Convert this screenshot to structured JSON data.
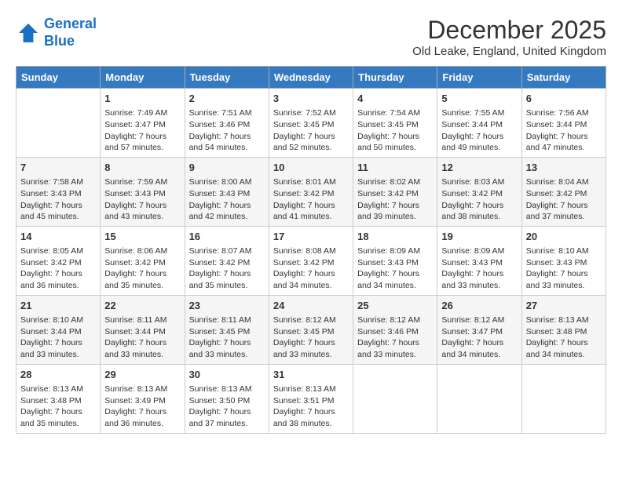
{
  "header": {
    "logo_line1": "General",
    "logo_line2": "Blue",
    "title": "December 2025",
    "subtitle": "Old Leake, England, United Kingdom"
  },
  "days_of_week": [
    "Sunday",
    "Monday",
    "Tuesday",
    "Wednesday",
    "Thursday",
    "Friday",
    "Saturday"
  ],
  "weeks": [
    [
      {
        "day": "",
        "info": ""
      },
      {
        "day": "1",
        "info": "Sunrise: 7:49 AM\nSunset: 3:47 PM\nDaylight: 7 hours\nand 57 minutes."
      },
      {
        "day": "2",
        "info": "Sunrise: 7:51 AM\nSunset: 3:46 PM\nDaylight: 7 hours\nand 54 minutes."
      },
      {
        "day": "3",
        "info": "Sunrise: 7:52 AM\nSunset: 3:45 PM\nDaylight: 7 hours\nand 52 minutes."
      },
      {
        "day": "4",
        "info": "Sunrise: 7:54 AM\nSunset: 3:45 PM\nDaylight: 7 hours\nand 50 minutes."
      },
      {
        "day": "5",
        "info": "Sunrise: 7:55 AM\nSunset: 3:44 PM\nDaylight: 7 hours\nand 49 minutes."
      },
      {
        "day": "6",
        "info": "Sunrise: 7:56 AM\nSunset: 3:44 PM\nDaylight: 7 hours\nand 47 minutes."
      }
    ],
    [
      {
        "day": "7",
        "info": "Sunrise: 7:58 AM\nSunset: 3:43 PM\nDaylight: 7 hours\nand 45 minutes."
      },
      {
        "day": "8",
        "info": "Sunrise: 7:59 AM\nSunset: 3:43 PM\nDaylight: 7 hours\nand 43 minutes."
      },
      {
        "day": "9",
        "info": "Sunrise: 8:00 AM\nSunset: 3:43 PM\nDaylight: 7 hours\nand 42 minutes."
      },
      {
        "day": "10",
        "info": "Sunrise: 8:01 AM\nSunset: 3:42 PM\nDaylight: 7 hours\nand 41 minutes."
      },
      {
        "day": "11",
        "info": "Sunrise: 8:02 AM\nSunset: 3:42 PM\nDaylight: 7 hours\nand 39 minutes."
      },
      {
        "day": "12",
        "info": "Sunrise: 8:03 AM\nSunset: 3:42 PM\nDaylight: 7 hours\nand 38 minutes."
      },
      {
        "day": "13",
        "info": "Sunrise: 8:04 AM\nSunset: 3:42 PM\nDaylight: 7 hours\nand 37 minutes."
      }
    ],
    [
      {
        "day": "14",
        "info": "Sunrise: 8:05 AM\nSunset: 3:42 PM\nDaylight: 7 hours\nand 36 minutes."
      },
      {
        "day": "15",
        "info": "Sunrise: 8:06 AM\nSunset: 3:42 PM\nDaylight: 7 hours\nand 35 minutes."
      },
      {
        "day": "16",
        "info": "Sunrise: 8:07 AM\nSunset: 3:42 PM\nDaylight: 7 hours\nand 35 minutes."
      },
      {
        "day": "17",
        "info": "Sunrise: 8:08 AM\nSunset: 3:42 PM\nDaylight: 7 hours\nand 34 minutes."
      },
      {
        "day": "18",
        "info": "Sunrise: 8:09 AM\nSunset: 3:43 PM\nDaylight: 7 hours\nand 34 minutes."
      },
      {
        "day": "19",
        "info": "Sunrise: 8:09 AM\nSunset: 3:43 PM\nDaylight: 7 hours\nand 33 minutes."
      },
      {
        "day": "20",
        "info": "Sunrise: 8:10 AM\nSunset: 3:43 PM\nDaylight: 7 hours\nand 33 minutes."
      }
    ],
    [
      {
        "day": "21",
        "info": "Sunrise: 8:10 AM\nSunset: 3:44 PM\nDaylight: 7 hours\nand 33 minutes."
      },
      {
        "day": "22",
        "info": "Sunrise: 8:11 AM\nSunset: 3:44 PM\nDaylight: 7 hours\nand 33 minutes."
      },
      {
        "day": "23",
        "info": "Sunrise: 8:11 AM\nSunset: 3:45 PM\nDaylight: 7 hours\nand 33 minutes."
      },
      {
        "day": "24",
        "info": "Sunrise: 8:12 AM\nSunset: 3:45 PM\nDaylight: 7 hours\nand 33 minutes."
      },
      {
        "day": "25",
        "info": "Sunrise: 8:12 AM\nSunset: 3:46 PM\nDaylight: 7 hours\nand 33 minutes."
      },
      {
        "day": "26",
        "info": "Sunrise: 8:12 AM\nSunset: 3:47 PM\nDaylight: 7 hours\nand 34 minutes."
      },
      {
        "day": "27",
        "info": "Sunrise: 8:13 AM\nSunset: 3:48 PM\nDaylight: 7 hours\nand 34 minutes."
      }
    ],
    [
      {
        "day": "28",
        "info": "Sunrise: 8:13 AM\nSunset: 3:48 PM\nDaylight: 7 hours\nand 35 minutes."
      },
      {
        "day": "29",
        "info": "Sunrise: 8:13 AM\nSunset: 3:49 PM\nDaylight: 7 hours\nand 36 minutes."
      },
      {
        "day": "30",
        "info": "Sunrise: 8:13 AM\nSunset: 3:50 PM\nDaylight: 7 hours\nand 37 minutes."
      },
      {
        "day": "31",
        "info": "Sunrise: 8:13 AM\nSunset: 3:51 PM\nDaylight: 7 hours\nand 38 minutes."
      },
      {
        "day": "",
        "info": ""
      },
      {
        "day": "",
        "info": ""
      },
      {
        "day": "",
        "info": ""
      }
    ]
  ]
}
